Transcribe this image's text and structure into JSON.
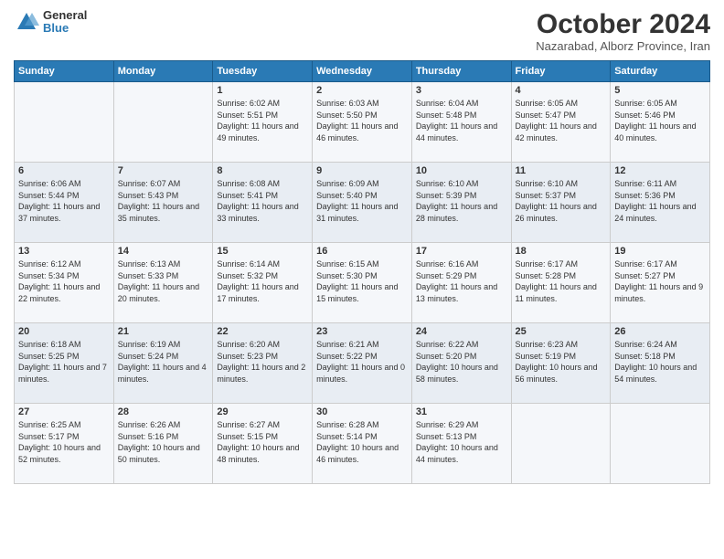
{
  "logo": {
    "general": "General",
    "blue": "Blue"
  },
  "title": "October 2024",
  "subtitle": "Nazarabad, Alborz Province, Iran",
  "headers": [
    "Sunday",
    "Monday",
    "Tuesday",
    "Wednesday",
    "Thursday",
    "Friday",
    "Saturday"
  ],
  "weeks": [
    [
      {
        "day": "",
        "text": ""
      },
      {
        "day": "",
        "text": ""
      },
      {
        "day": "1",
        "text": "Sunrise: 6:02 AM\nSunset: 5:51 PM\nDaylight: 11 hours and 49 minutes."
      },
      {
        "day": "2",
        "text": "Sunrise: 6:03 AM\nSunset: 5:50 PM\nDaylight: 11 hours and 46 minutes."
      },
      {
        "day": "3",
        "text": "Sunrise: 6:04 AM\nSunset: 5:48 PM\nDaylight: 11 hours and 44 minutes."
      },
      {
        "day": "4",
        "text": "Sunrise: 6:05 AM\nSunset: 5:47 PM\nDaylight: 11 hours and 42 minutes."
      },
      {
        "day": "5",
        "text": "Sunrise: 6:05 AM\nSunset: 5:46 PM\nDaylight: 11 hours and 40 minutes."
      }
    ],
    [
      {
        "day": "6",
        "text": "Sunrise: 6:06 AM\nSunset: 5:44 PM\nDaylight: 11 hours and 37 minutes."
      },
      {
        "day": "7",
        "text": "Sunrise: 6:07 AM\nSunset: 5:43 PM\nDaylight: 11 hours and 35 minutes."
      },
      {
        "day": "8",
        "text": "Sunrise: 6:08 AM\nSunset: 5:41 PM\nDaylight: 11 hours and 33 minutes."
      },
      {
        "day": "9",
        "text": "Sunrise: 6:09 AM\nSunset: 5:40 PM\nDaylight: 11 hours and 31 minutes."
      },
      {
        "day": "10",
        "text": "Sunrise: 6:10 AM\nSunset: 5:39 PM\nDaylight: 11 hours and 28 minutes."
      },
      {
        "day": "11",
        "text": "Sunrise: 6:10 AM\nSunset: 5:37 PM\nDaylight: 11 hours and 26 minutes."
      },
      {
        "day": "12",
        "text": "Sunrise: 6:11 AM\nSunset: 5:36 PM\nDaylight: 11 hours and 24 minutes."
      }
    ],
    [
      {
        "day": "13",
        "text": "Sunrise: 6:12 AM\nSunset: 5:34 PM\nDaylight: 11 hours and 22 minutes."
      },
      {
        "day": "14",
        "text": "Sunrise: 6:13 AM\nSunset: 5:33 PM\nDaylight: 11 hours and 20 minutes."
      },
      {
        "day": "15",
        "text": "Sunrise: 6:14 AM\nSunset: 5:32 PM\nDaylight: 11 hours and 17 minutes."
      },
      {
        "day": "16",
        "text": "Sunrise: 6:15 AM\nSunset: 5:30 PM\nDaylight: 11 hours and 15 minutes."
      },
      {
        "day": "17",
        "text": "Sunrise: 6:16 AM\nSunset: 5:29 PM\nDaylight: 11 hours and 13 minutes."
      },
      {
        "day": "18",
        "text": "Sunrise: 6:17 AM\nSunset: 5:28 PM\nDaylight: 11 hours and 11 minutes."
      },
      {
        "day": "19",
        "text": "Sunrise: 6:17 AM\nSunset: 5:27 PM\nDaylight: 11 hours and 9 minutes."
      }
    ],
    [
      {
        "day": "20",
        "text": "Sunrise: 6:18 AM\nSunset: 5:25 PM\nDaylight: 11 hours and 7 minutes."
      },
      {
        "day": "21",
        "text": "Sunrise: 6:19 AM\nSunset: 5:24 PM\nDaylight: 11 hours and 4 minutes."
      },
      {
        "day": "22",
        "text": "Sunrise: 6:20 AM\nSunset: 5:23 PM\nDaylight: 11 hours and 2 minutes."
      },
      {
        "day": "23",
        "text": "Sunrise: 6:21 AM\nSunset: 5:22 PM\nDaylight: 11 hours and 0 minutes."
      },
      {
        "day": "24",
        "text": "Sunrise: 6:22 AM\nSunset: 5:20 PM\nDaylight: 10 hours and 58 minutes."
      },
      {
        "day": "25",
        "text": "Sunrise: 6:23 AM\nSunset: 5:19 PM\nDaylight: 10 hours and 56 minutes."
      },
      {
        "day": "26",
        "text": "Sunrise: 6:24 AM\nSunset: 5:18 PM\nDaylight: 10 hours and 54 minutes."
      }
    ],
    [
      {
        "day": "27",
        "text": "Sunrise: 6:25 AM\nSunset: 5:17 PM\nDaylight: 10 hours and 52 minutes."
      },
      {
        "day": "28",
        "text": "Sunrise: 6:26 AM\nSunset: 5:16 PM\nDaylight: 10 hours and 50 minutes."
      },
      {
        "day": "29",
        "text": "Sunrise: 6:27 AM\nSunset: 5:15 PM\nDaylight: 10 hours and 48 minutes."
      },
      {
        "day": "30",
        "text": "Sunrise: 6:28 AM\nSunset: 5:14 PM\nDaylight: 10 hours and 46 minutes."
      },
      {
        "day": "31",
        "text": "Sunrise: 6:29 AM\nSunset: 5:13 PM\nDaylight: 10 hours and 44 minutes."
      },
      {
        "day": "",
        "text": ""
      },
      {
        "day": "",
        "text": ""
      }
    ]
  ]
}
